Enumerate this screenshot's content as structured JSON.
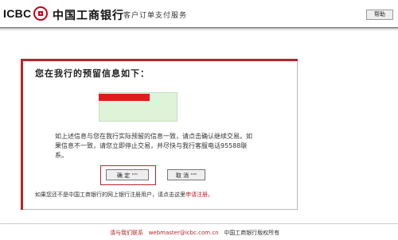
{
  "header": {
    "brand": "ICBC",
    "bank_name": "中国工商银行",
    "service_name": "客户订单支付服务",
    "help_label": "帮助"
  },
  "panel": {
    "title": "您在我行的预留信息如下：",
    "message": "如上述信息与您在我行实际预留的信息一致，请点击确认继续交易。如果信息不一致，请您立即停止交易，并尽快与我行客服电话95588联系。",
    "ok_label": "确 定 ''''",
    "cancel_label": "取 消 ''''",
    "note_text": "如果您还不是中国工商银行的网上银行注册用户，请点击这里",
    "note_link": "申请注册。"
  },
  "footer": {
    "contact_label": "请与我们联系",
    "email": "webmaster@icbc.com.cn",
    "copyright": "中国工商银行版权所有"
  },
  "colors": {
    "brand_red": "#b0272e",
    "info_bg": "#dff3d8",
    "info_bar": "#e01b1b"
  }
}
